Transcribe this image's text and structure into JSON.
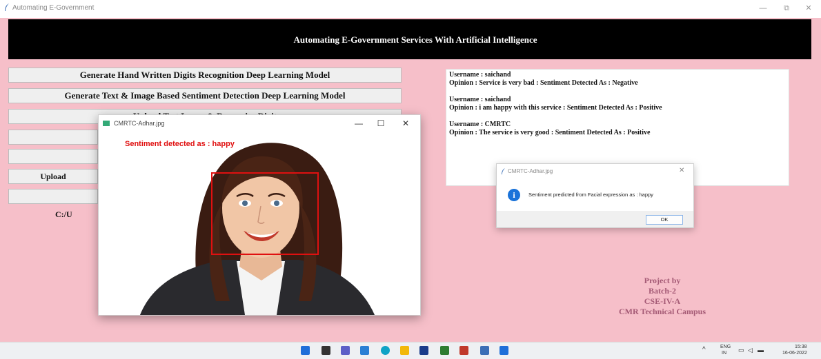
{
  "window": {
    "title": "Automating E-Government",
    "minimize": "—",
    "maximize": "⧉",
    "close": "✕"
  },
  "banner": {
    "title": "Automating E-Government Services With Artificial Intelligence"
  },
  "buttons": {
    "b1": "Generate Hand Written Digits Recognition Deep Learning Model",
    "b2": "Generate Text & Image Based Sentiment Detection Deep Learning Model",
    "b3": "Upload Test Image & Recognize Digit",
    "b6": "Upload",
    "path": "C:/U"
  },
  "output": {
    "entries": [
      {
        "username": "Username : saichand",
        "opinion": "Opinion  : Service is very bad : Sentiment Detected As : Negative"
      },
      {
        "username": "Username : saichand",
        "opinion": "Opinion  : i am happy with this service : Sentiment Detected As : Positive"
      },
      {
        "username": "Username : CMRTC",
        "opinion": "Opinion  : The service is very good : Sentiment Detected As : Positive"
      }
    ]
  },
  "credits": {
    "line1": "Project by",
    "line2": "Batch-2",
    "line3": "CSE-IV-A",
    "line4": "CMR Technical Campus"
  },
  "image_window": {
    "title": "CMRTC-Adhar.jpg",
    "minimize": "—",
    "maximize": "☐",
    "close": "✕",
    "overlay_text": "Sentiment detected as : happy"
  },
  "message_box": {
    "title": "CMRTC-Adhar.jpg",
    "close": "✕",
    "message": "Sentiment predicted from Facial expression as : happy",
    "ok": "OK"
  },
  "taskbar": {
    "lang": "ENG",
    "region": "IN",
    "time": "15:38",
    "date": "16-06-2022",
    "chevron": "^"
  },
  "colors": {
    "background": "#f6bfc9",
    "banner": "#000000",
    "accent_red": "#e01010",
    "info_blue": "#1a73d9",
    "credits": "#a55b76"
  }
}
